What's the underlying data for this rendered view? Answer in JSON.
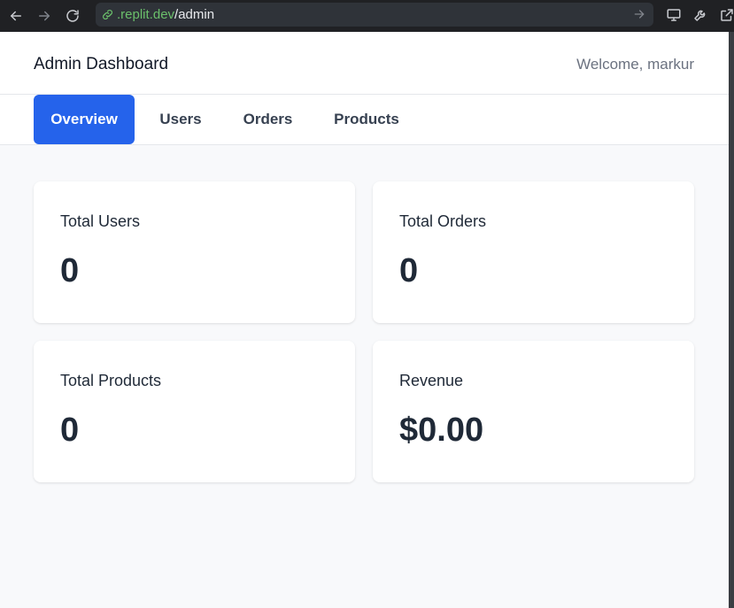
{
  "browser": {
    "url_domain": ".replit.dev",
    "url_path": "/admin",
    "icons": [
      "back-icon",
      "forward-icon",
      "reload-icon",
      "link-icon",
      "go-icon",
      "screen-icon",
      "wrench-icon",
      "external-icon"
    ]
  },
  "header": {
    "title": "Admin Dashboard",
    "welcome": "Welcome, markur"
  },
  "tabs": [
    {
      "label": "Overview",
      "active": true
    },
    {
      "label": "Users",
      "active": false
    },
    {
      "label": "Orders",
      "active": false
    },
    {
      "label": "Products",
      "active": false
    }
  ],
  "stats": [
    {
      "label": "Total Users",
      "value": "0"
    },
    {
      "label": "Total Orders",
      "value": "0"
    },
    {
      "label": "Total Products",
      "value": "0"
    },
    {
      "label": "Revenue",
      "value": "$0.00"
    }
  ],
  "colors": {
    "accent": "#2563eb",
    "page_bg": "#f8f9fb",
    "card_bg": "#ffffff",
    "url_domain": "#6bbf6b"
  }
}
